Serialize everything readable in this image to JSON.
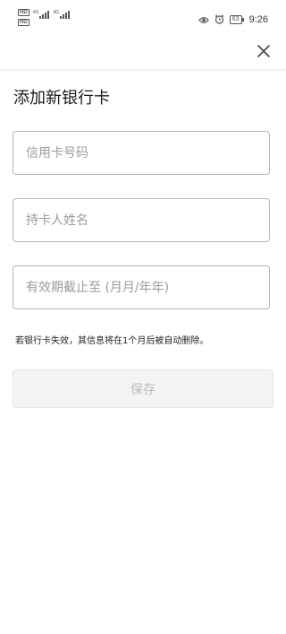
{
  "status_bar": {
    "net_badge": "HD",
    "signal_tag": "4G",
    "battery": "63",
    "time": "9:26"
  },
  "page": {
    "title": "添加新银行卡"
  },
  "form": {
    "card_number_placeholder": "信用卡号码",
    "holder_name_placeholder": "持卡人姓名",
    "expiry_placeholder": "有效期截止至 (月月/年年)"
  },
  "notice": "若银行卡失效，其信息将在1个月后被自动删除。",
  "actions": {
    "save_label": "保存"
  }
}
